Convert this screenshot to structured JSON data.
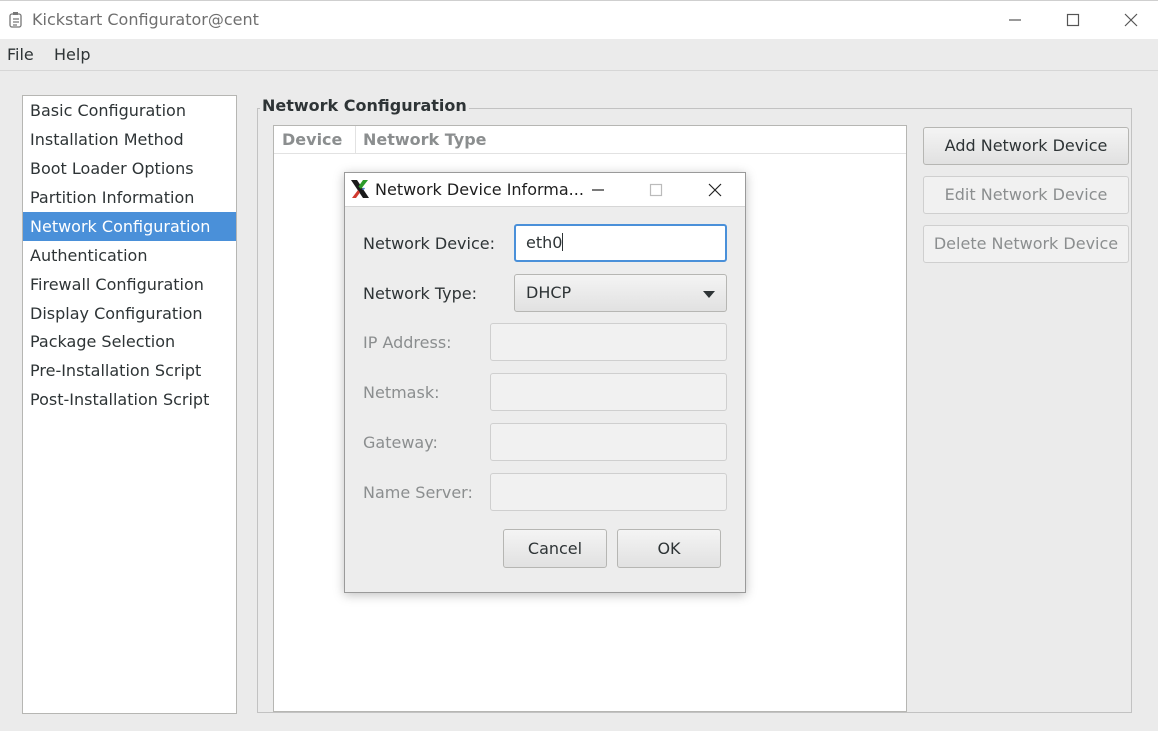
{
  "window": {
    "title": "Kickstart Configurator@cent",
    "icons": {
      "app": "app-icon",
      "minimize": "minimize-icon",
      "maximize": "maximize-icon",
      "close": "close-icon"
    }
  },
  "menu": {
    "items": [
      "File",
      "Help"
    ]
  },
  "sidebar": {
    "items": [
      "Basic Configuration",
      "Installation Method",
      "Boot Loader Options",
      "Partition Information",
      "Network Configuration",
      "Authentication",
      "Firewall Configuration",
      "Display Configuration",
      "Package Selection",
      "Pre-Installation Script",
      "Post-Installation Script"
    ],
    "selected": "Network Configuration"
  },
  "main": {
    "section_title": "Network Configuration",
    "columns": [
      "Device",
      "Network Type"
    ],
    "buttons": {
      "add": "Add Network Device",
      "edit": "Edit Network Device",
      "delete": "Delete Network Device"
    }
  },
  "dialog": {
    "title": "Network Device Informa...",
    "fields": {
      "device_label": "Network Device:",
      "device_value": "eth0",
      "type_label": "Network Type:",
      "type_value": "DHCP",
      "ip_label": "IP Address:",
      "netmask_label": "Netmask:",
      "gateway_label": "Gateway:",
      "nameserver_label": "Name Server:"
    },
    "buttons": {
      "cancel": "Cancel",
      "ok": "OK"
    }
  },
  "colors": {
    "selection": "#4a90d9",
    "window_bg": "#ebebeb",
    "disabled_text": "#8b8e8f"
  }
}
